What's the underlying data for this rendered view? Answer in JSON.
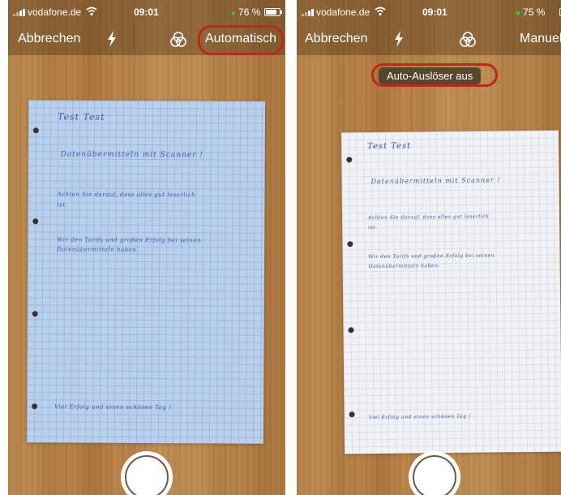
{
  "left": {
    "status": {
      "carrier": "vodafone.de",
      "time": "09:01",
      "battery": "76 %"
    },
    "toolbar": {
      "cancel": "Abbrechen",
      "mode": "Automatisch"
    },
    "paper": {
      "title": "Test     Test",
      "line1": "Datenübermitteln mit  Scanner !",
      "line2": "Achten Sie darauf, dass alles gut leserlich",
      "line3": "ist.",
      "line4": "Wir den Tarifs und großen Erfolg bei seinen",
      "line5": "Datenübermitteln haben.",
      "line6": "Viel Erfolg und einen schönen Tag !"
    }
  },
  "right": {
    "status": {
      "carrier": "vodafone.de",
      "time": "09:01",
      "battery": "75 %"
    },
    "toolbar": {
      "cancel": "Abbrechen",
      "mode": "Manuell"
    },
    "notice": "Auto-Auslöser aus",
    "paper": {
      "title": "Test     Test",
      "line1": "Datenübermitteln mit  Scanner !",
      "line2": "Achten Sie darauf, dass alles gut leserlich",
      "line3": "ist.",
      "line4": "Wir den Tarifs und großen Erfolg bei seinen",
      "line5": "Datenübermitteln haben.",
      "line6": "Viel Erfolg und einen schönen Tag !"
    }
  },
  "icons": [
    "signal-icon",
    "wifi-icon",
    "battery-icon",
    "flash-icon",
    "filter-icon",
    "shutter-button"
  ],
  "colors": {
    "highlight": "#c0251e",
    "battery_dot": "#2ecc40"
  }
}
